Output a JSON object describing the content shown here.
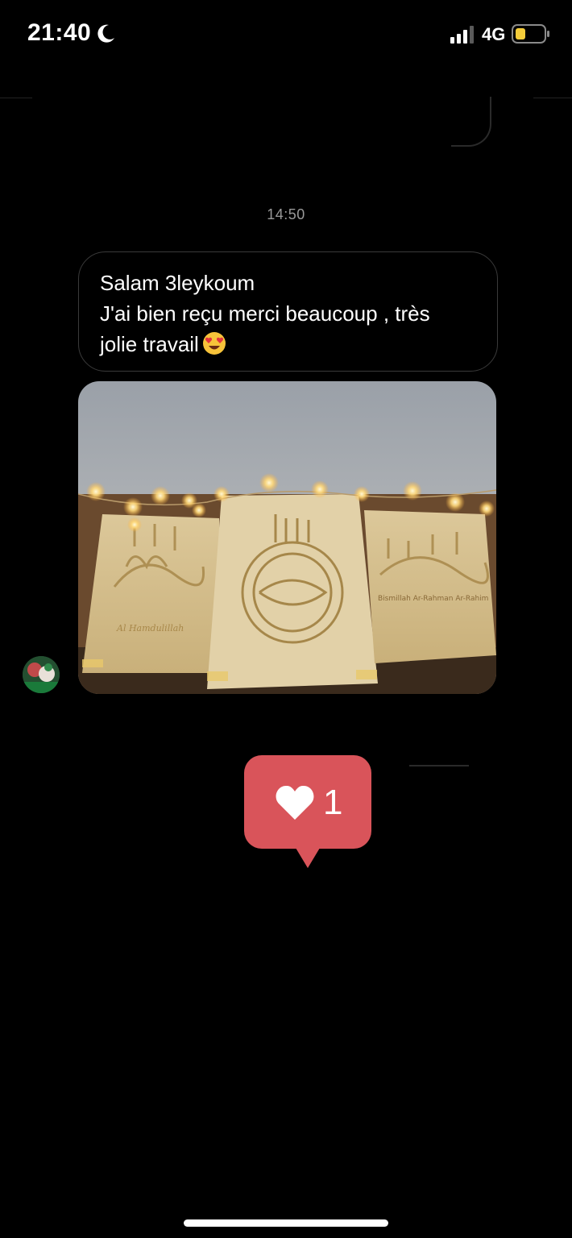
{
  "status_bar": {
    "time": "21:40",
    "network": "4G",
    "icons": [
      "moon-icon",
      "signal-icon",
      "battery-icon"
    ],
    "battery_color": "#f5cd3a"
  },
  "conversation": {
    "timestamp": "14:50",
    "message": {
      "lines": [
        "Salam 3leykoum",
        "J'ai bien reçu merci beaucoup , très",
        "jolie travail"
      ],
      "emoji": "heart-eyes-emoji"
    },
    "photo": {
      "labels": {
        "left": "Al Hamdulillah",
        "right": "Bismillah Ar-Rahman Ar-Rahim"
      }
    },
    "reactions": {
      "icon": "heart-icon",
      "count": "1",
      "color": "#d9545a"
    }
  },
  "colors": {
    "background": "#000000",
    "bubble_border": "#3a3a3a",
    "timestamp": "#9a9a9a"
  }
}
